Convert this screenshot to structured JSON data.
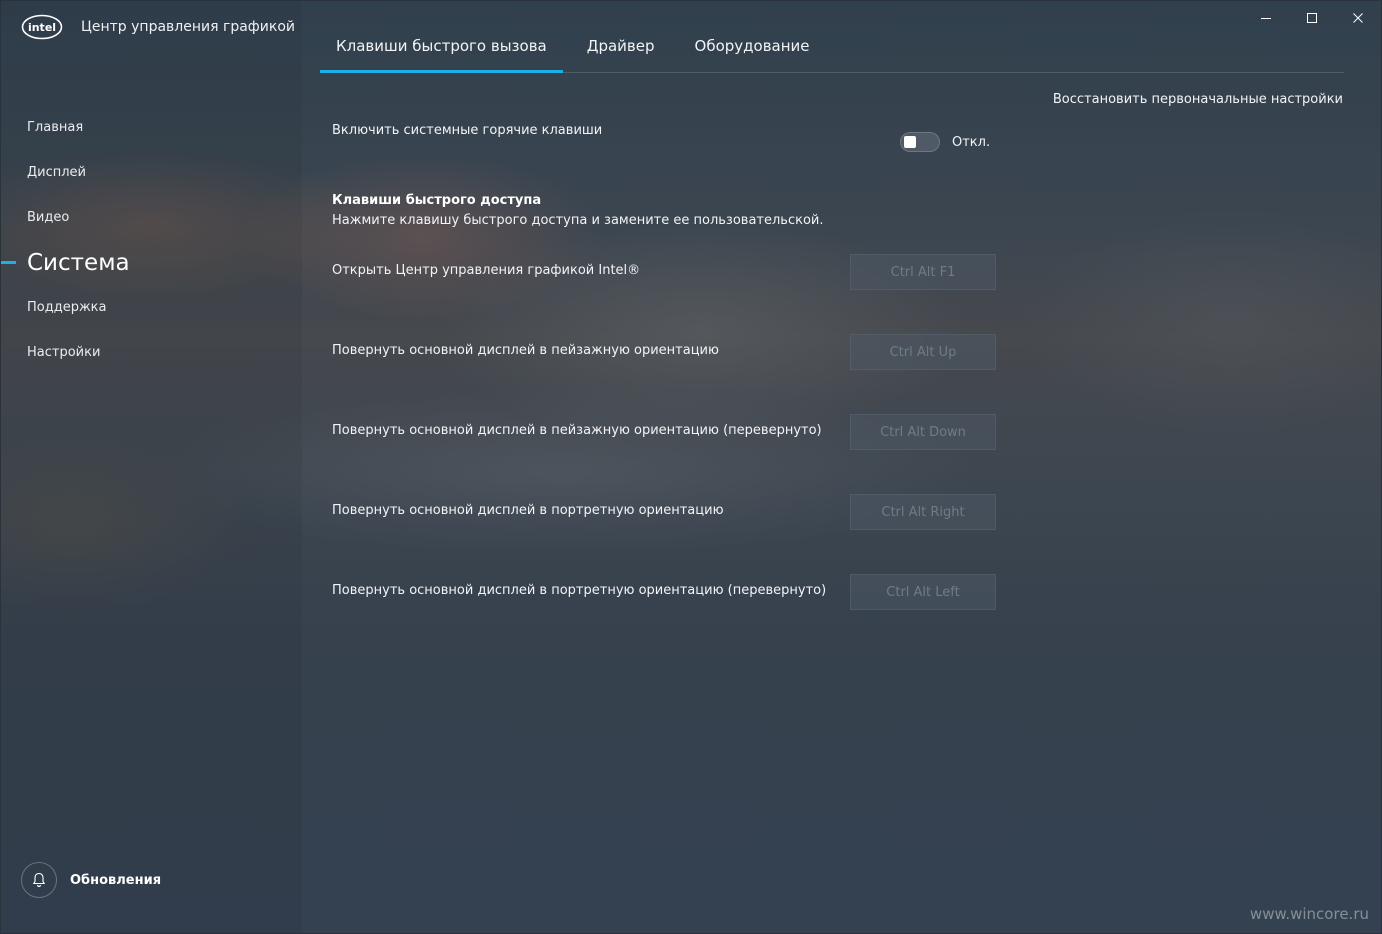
{
  "app": {
    "logo_text": "intel",
    "title": "Центр управления графикой"
  },
  "window_controls": {
    "minimize": "minimize-icon",
    "maximize": "maximize-icon",
    "close": "close-icon"
  },
  "sidebar": {
    "items": [
      {
        "label": "Главная",
        "active": false
      },
      {
        "label": "Дисплей",
        "active": false
      },
      {
        "label": "Видео",
        "active": false
      },
      {
        "label": "Система",
        "active": true
      },
      {
        "label": "Поддержка",
        "active": false
      },
      {
        "label": "Настройки",
        "active": false
      }
    ],
    "updates": {
      "label": "Обновления",
      "icon": "bell-icon"
    }
  },
  "tabs": [
    {
      "label": "Клавиши быстрого вызова",
      "active": true
    },
    {
      "label": "Драйвер",
      "active": false
    },
    {
      "label": "Оборудование",
      "active": false
    }
  ],
  "main": {
    "reset_label": "Восстановить первоначальные настройки",
    "system_hotkeys": {
      "label": "Включить системные горячие клавиши",
      "state_label": "Откл.",
      "enabled": false
    },
    "section_title": "Клавиши быстрого доступа",
    "section_desc": "Нажмите клавишу быстрого доступа и замените ее пользовательской.",
    "hotkeys": [
      {
        "label": "Открыть Центр управления графикой Intel®",
        "keys": "Ctrl Alt F1"
      },
      {
        "label": "Повернуть основной дисплей в пейзажную ориентацию",
        "keys": "Ctrl Alt Up"
      },
      {
        "label": "Повернуть основной дисплей в пейзажную ориентацию (перевернуто)",
        "keys": "Ctrl Alt Down"
      },
      {
        "label": "Повернуть основной дисплей в портретную ориентацию",
        "keys": "Ctrl Alt Right"
      },
      {
        "label": "Повернуть основной дисплей в портретную ориентацию (перевернуто)",
        "keys": "Ctrl Alt Left"
      }
    ]
  },
  "watermark": "www.wincore.ru",
  "colors": {
    "accent": "#1bb0e8"
  }
}
